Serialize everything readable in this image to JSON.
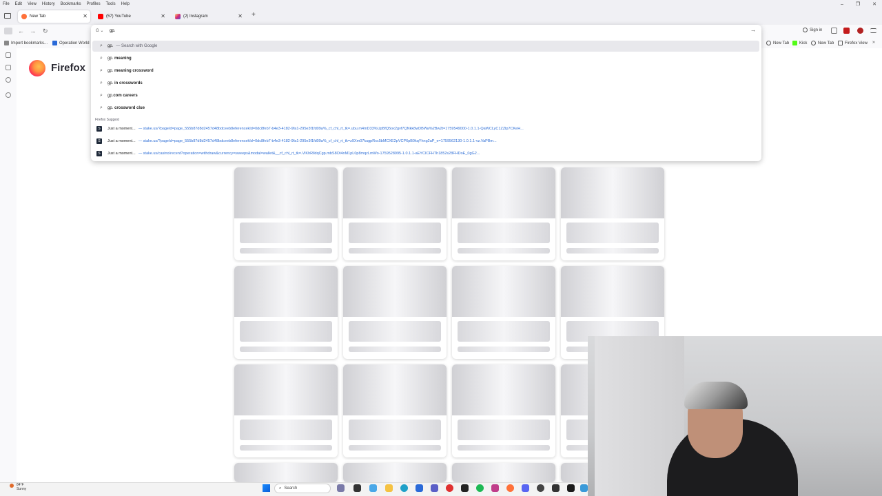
{
  "menubar": {
    "items": [
      "File",
      "Edit",
      "View",
      "History",
      "Bookmarks",
      "Profiles",
      "Tools",
      "Help"
    ]
  },
  "window_controls": {
    "minimize": "–",
    "restore": "❐",
    "close": "✕"
  },
  "tabs": [
    {
      "title": "New Tab",
      "active": true,
      "favicon_color": "#ff7139"
    },
    {
      "title": "(57) YouTube",
      "active": false,
      "favicon_color": "#ff0000"
    },
    {
      "title": "(2) Instagram",
      "active": false,
      "favicon_color": "#d6249f"
    }
  ],
  "tab_close_glyph": "✕",
  "new_tab_glyph": "+",
  "nav": {
    "back": "←",
    "forward": "→",
    "reload": "↻",
    "signin": "Sign in"
  },
  "urlbar": {
    "engine": "G ⌄",
    "value": "gp.",
    "go": "→"
  },
  "suggestions": [
    {
      "prefix": "gp.",
      "bold": "",
      "hint": "— Search with Google",
      "selected": true
    },
    {
      "prefix": "gp.",
      "bold": " meaning",
      "hint": "",
      "selected": false
    },
    {
      "prefix": "gp.",
      "bold": " meaning crossword",
      "hint": "",
      "selected": false
    },
    {
      "prefix": "gp.",
      "bold": " in crosswords",
      "hint": "",
      "selected": false
    },
    {
      "prefix": "gp.",
      "bold": "com careers",
      "hint": "",
      "selected": false
    },
    {
      "prefix": "gp.",
      "bold": " crossword clue",
      "hint": "",
      "selected": false
    }
  ],
  "section_label": "Firefox Suggest",
  "history": [
    {
      "title": "Just a moment...",
      "url": "— stake.us/?pageId=page_555b87d8d2457d48bdceeb8eferencekId=0dc8feb7-b4e3-4182-9fa1-295e3f1fd09a%_cf_chl_rt_tk=.ubu.m4mD33%UpBfQ5ox2gvf7QNkk8wDBWa%2Bw2t=1759549000-1.0.1.1-QaWCLyC1ZZlp7CKeH..."
    },
    {
      "title": "Just a moment...",
      "url": "— stake.us/?pageId=page_555b87d8d2457d48bdceeb8eferencekId=0dc8feb7-b4e3-4182-9fa1-295e3f1fd09a%_cf_chl_rt_tk=z9Xm07kugpRxc5bMCXE2pVCP6pB0kqYhng2aP_e=1759562130-1.0.1.1-vz.VaPBm..."
    },
    {
      "title": "Just a moment...",
      "url": "— stake.us/casino/recent?operation=withdraw&currency=sweeps&modal=wallet&__cf_chl_rt_tk=.VlKhRlldqCgp.mbS8Ot4nM1pL0p8mqzLmWo-1759528995-1.0.1.1-aEYCICFHTh1852s28FHDoE_0gG2..."
    }
  ],
  "bookmarks": [
    {
      "label": "Import bookmarks...",
      "color": "#888888"
    },
    {
      "label": "Operation World",
      "color": "#2a6ad8"
    }
  ],
  "bookmarks_right": [
    {
      "label": "New Tab",
      "color": "#555555"
    },
    {
      "label": "Kick",
      "color": "#53fc18"
    },
    {
      "label": "New Tab",
      "color": "#555555"
    },
    {
      "label": "Firefox View",
      "color": "#555555"
    }
  ],
  "brand": {
    "wordmark": "Firefox"
  },
  "taskbar": {
    "search_label": "Search",
    "weather_temp": "84°F",
    "weather_desc": "Sunny"
  }
}
